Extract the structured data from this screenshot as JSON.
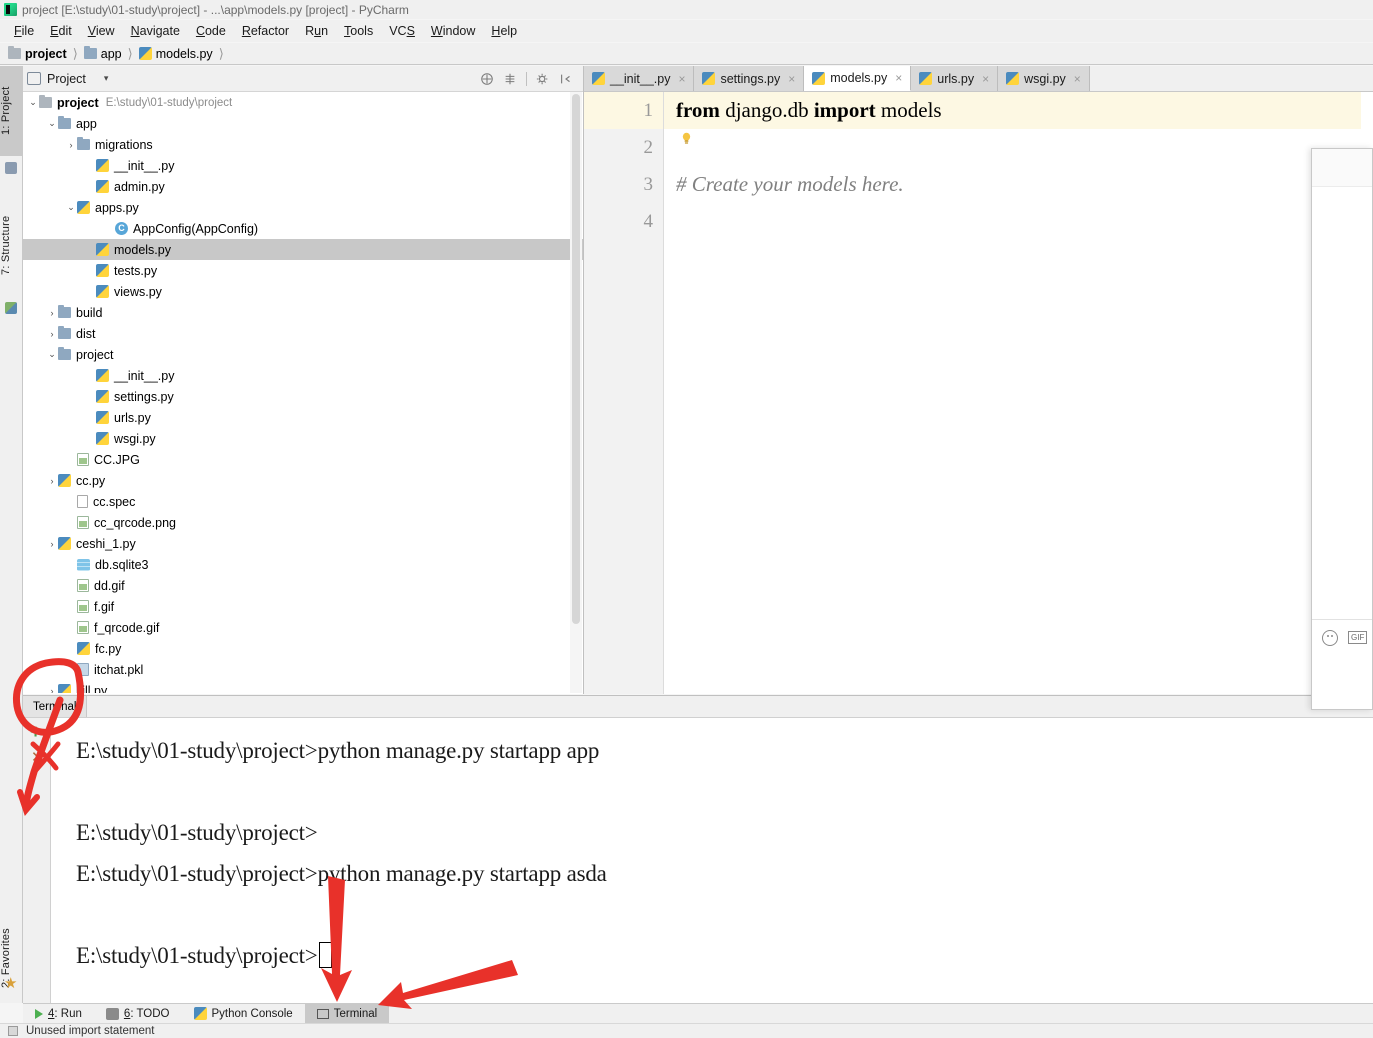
{
  "window": {
    "title": "project [E:\\study\\01-study\\project] - ...\\app\\models.py [project] - PyCharm",
    "app_logo": "pycharm-logo"
  },
  "menubar": {
    "items": [
      {
        "label": "File",
        "mnemonic": "F"
      },
      {
        "label": "Edit",
        "mnemonic": "E"
      },
      {
        "label": "View",
        "mnemonic": "V"
      },
      {
        "label": "Navigate",
        "mnemonic": "N"
      },
      {
        "label": "Code",
        "mnemonic": "C"
      },
      {
        "label": "Refactor",
        "mnemonic": "R"
      },
      {
        "label": "Run",
        "mnemonic": "u"
      },
      {
        "label": "Tools",
        "mnemonic": "T"
      },
      {
        "label": "VCS",
        "mnemonic": "S"
      },
      {
        "label": "Window",
        "mnemonic": "W"
      },
      {
        "label": "Help",
        "mnemonic": "H"
      }
    ]
  },
  "breadcrumb": {
    "items": [
      {
        "label": "project",
        "icon": "folder-icon",
        "bold": true
      },
      {
        "label": "app",
        "icon": "folder-icon",
        "bold": false
      },
      {
        "label": "models.py",
        "icon": "python-file-icon",
        "bold": false
      }
    ]
  },
  "left_strip": {
    "tabs": [
      {
        "label": "1: Project",
        "active": true
      },
      {
        "label": "7: Structure",
        "active": false
      }
    ],
    "bottom_tabs": [
      {
        "label": "2: Favorites",
        "icon": "star-icon"
      }
    ]
  },
  "project_panel": {
    "header": {
      "title": "Project",
      "icon": "project-view-icon",
      "caret": "▾",
      "tools": [
        "collapse-all-icon",
        "expand-selection-icon",
        "settings-gear-icon",
        "hide-panel-icon"
      ]
    },
    "tree": [
      {
        "indent": 0,
        "arrow": "⌄",
        "icon": "folder-icon",
        "label": "project",
        "bold": true,
        "path": "E:\\study\\01-study\\project",
        "selected": false
      },
      {
        "indent": 1,
        "arrow": "⌄",
        "icon": "folder-blue-icon",
        "label": "app",
        "bold": false,
        "path": "",
        "selected": false
      },
      {
        "indent": 2,
        "arrow": "›",
        "icon": "folder-blue-icon",
        "label": "migrations",
        "bold": false,
        "path": "",
        "selected": false
      },
      {
        "indent": 3,
        "arrow": "",
        "icon": "python-file-icon",
        "label": "__init__.py",
        "bold": false,
        "path": "",
        "selected": false
      },
      {
        "indent": 3,
        "arrow": "",
        "icon": "python-file-icon",
        "label": "admin.py",
        "bold": false,
        "path": "",
        "selected": false
      },
      {
        "indent": 2,
        "arrow": "⌄",
        "icon": "python-file-icon",
        "label": "apps.py",
        "bold": false,
        "path": "",
        "selected": false
      },
      {
        "indent": 4,
        "arrow": "",
        "icon": "class-icon",
        "label": "AppConfig(AppConfig)",
        "bold": false,
        "path": "",
        "selected": false
      },
      {
        "indent": 3,
        "arrow": "",
        "icon": "python-file-icon",
        "label": "models.py",
        "bold": false,
        "path": "",
        "selected": true
      },
      {
        "indent": 3,
        "arrow": "",
        "icon": "python-file-icon",
        "label": "tests.py",
        "bold": false,
        "path": "",
        "selected": false
      },
      {
        "indent": 3,
        "arrow": "",
        "icon": "python-file-icon",
        "label": "views.py",
        "bold": false,
        "path": "",
        "selected": false
      },
      {
        "indent": 1,
        "arrow": "›",
        "icon": "folder-blue-icon",
        "label": "build",
        "bold": false,
        "path": "",
        "selected": false
      },
      {
        "indent": 1,
        "arrow": "›",
        "icon": "folder-blue-icon",
        "label": "dist",
        "bold": false,
        "path": "",
        "selected": false
      },
      {
        "indent": 1,
        "arrow": "⌄",
        "icon": "folder-blue-icon",
        "label": "project",
        "bold": false,
        "path": "",
        "selected": false
      },
      {
        "indent": 3,
        "arrow": "",
        "icon": "python-file-icon",
        "label": "__init__.py",
        "bold": false,
        "path": "",
        "selected": false
      },
      {
        "indent": 3,
        "arrow": "",
        "icon": "python-file-icon",
        "label": "settings.py",
        "bold": false,
        "path": "",
        "selected": false
      },
      {
        "indent": 3,
        "arrow": "",
        "icon": "python-file-icon",
        "label": "urls.py",
        "bold": false,
        "path": "",
        "selected": false
      },
      {
        "indent": 3,
        "arrow": "",
        "icon": "python-file-icon",
        "label": "wsgi.py",
        "bold": false,
        "path": "",
        "selected": false
      },
      {
        "indent": 2,
        "arrow": "",
        "icon": "image-file-icon",
        "label": "CC.JPG",
        "bold": false,
        "path": "",
        "selected": false
      },
      {
        "indent": 1,
        "arrow": "›",
        "icon": "python-file-icon",
        "label": "cc.py",
        "bold": false,
        "path": "",
        "selected": false
      },
      {
        "indent": 2,
        "arrow": "",
        "icon": "text-file-icon",
        "label": "cc.spec",
        "bold": false,
        "path": "",
        "selected": false
      },
      {
        "indent": 2,
        "arrow": "",
        "icon": "image-file-icon",
        "label": "cc_qrcode.png",
        "bold": false,
        "path": "",
        "selected": false
      },
      {
        "indent": 1,
        "arrow": "›",
        "icon": "python-file-icon",
        "label": "ceshi_1.py",
        "bold": false,
        "path": "",
        "selected": false
      },
      {
        "indent": 2,
        "arrow": "",
        "icon": "database-icon",
        "label": "db.sqlite3",
        "bold": false,
        "path": "",
        "selected": false
      },
      {
        "indent": 2,
        "arrow": "",
        "icon": "image-file-icon",
        "label": "dd.gif",
        "bold": false,
        "path": "",
        "selected": false
      },
      {
        "indent": 2,
        "arrow": "",
        "icon": "image-file-icon",
        "label": "f.gif",
        "bold": false,
        "path": "",
        "selected": false
      },
      {
        "indent": 2,
        "arrow": "",
        "icon": "image-file-icon",
        "label": "f_qrcode.gif",
        "bold": false,
        "path": "",
        "selected": false
      },
      {
        "indent": 2,
        "arrow": "",
        "icon": "python-file-icon",
        "label": "fc.py",
        "bold": false,
        "path": "",
        "selected": false
      },
      {
        "indent": 2,
        "arrow": "",
        "icon": "pickle-file-icon",
        "label": "itchat.pkl",
        "bold": false,
        "path": "",
        "selected": false
      },
      {
        "indent": 1,
        "arrow": "›",
        "icon": "python-file-icon",
        "label": "kill.py",
        "bold": false,
        "path": "",
        "selected": false
      }
    ]
  },
  "editor": {
    "tabs": [
      {
        "label": "__init__.py",
        "icon": "python-file-icon",
        "active": false,
        "close": "×"
      },
      {
        "label": "settings.py",
        "icon": "python-file-icon",
        "active": false,
        "close": "×"
      },
      {
        "label": "models.py",
        "icon": "python-file-icon",
        "active": true,
        "close": "×"
      },
      {
        "label": "urls.py",
        "icon": "python-file-icon",
        "active": false,
        "close": "×"
      },
      {
        "label": "wsgi.py",
        "icon": "python-file-icon",
        "active": false,
        "close": "×"
      }
    ],
    "line_numbers": [
      "1",
      "2",
      "3",
      "4"
    ],
    "lines": [
      {
        "num": "1",
        "current": true,
        "segments": [
          {
            "text": "from ",
            "style": "kw"
          },
          {
            "text": "django.db ",
            "style": "plain"
          },
          {
            "text": "import ",
            "style": "kw"
          },
          {
            "text": "models",
            "style": "plain"
          }
        ]
      },
      {
        "num": "2",
        "current": false,
        "segments": []
      },
      {
        "num": "3",
        "current": false,
        "segments": [
          {
            "text": "# Create your models here.",
            "style": "cm"
          }
        ]
      },
      {
        "num": "4",
        "current": false,
        "segments": []
      }
    ],
    "intention_icon": "lightbulb-icon"
  },
  "terminal": {
    "tab_label": "Terminal",
    "new_session_icon": "plus-icon",
    "close_session_icon": "close-icon",
    "lines": [
      "E:\\study\\01-study\\project>python manage.py startapp app",
      "",
      "E:\\study\\01-study\\project>",
      "E:\\study\\01-study\\project>python manage.py startapp asda",
      "",
      "E:\\study\\01-study\\project>"
    ]
  },
  "bottom_bar": {
    "buttons": [
      {
        "label": "4: Run",
        "icon": "run-icon",
        "active": false
      },
      {
        "label": "6: TODO",
        "icon": "todo-icon",
        "active": false
      },
      {
        "label": "Python Console",
        "icon": "python-console-icon",
        "active": false
      },
      {
        "label": "Terminal",
        "icon": "terminal-icon",
        "active": true
      }
    ]
  },
  "status_bar": {
    "message": "Unused import statement",
    "icon": "inspection-icon"
  },
  "overlay": {
    "emoji_icon": "emoji-icon",
    "gif_label": "GIF"
  },
  "annotations": {
    "color": "#e8312a",
    "marks": [
      "circle-around-terminal-tab",
      "arrow-to-terminal-button-1",
      "arrow-to-terminal-button-2"
    ]
  },
  "colors": {
    "selection": "#c8c8c8",
    "current_line": "#fdf8e3",
    "annotation_red": "#e8312a",
    "panel_bg": "#f0f0f0"
  }
}
